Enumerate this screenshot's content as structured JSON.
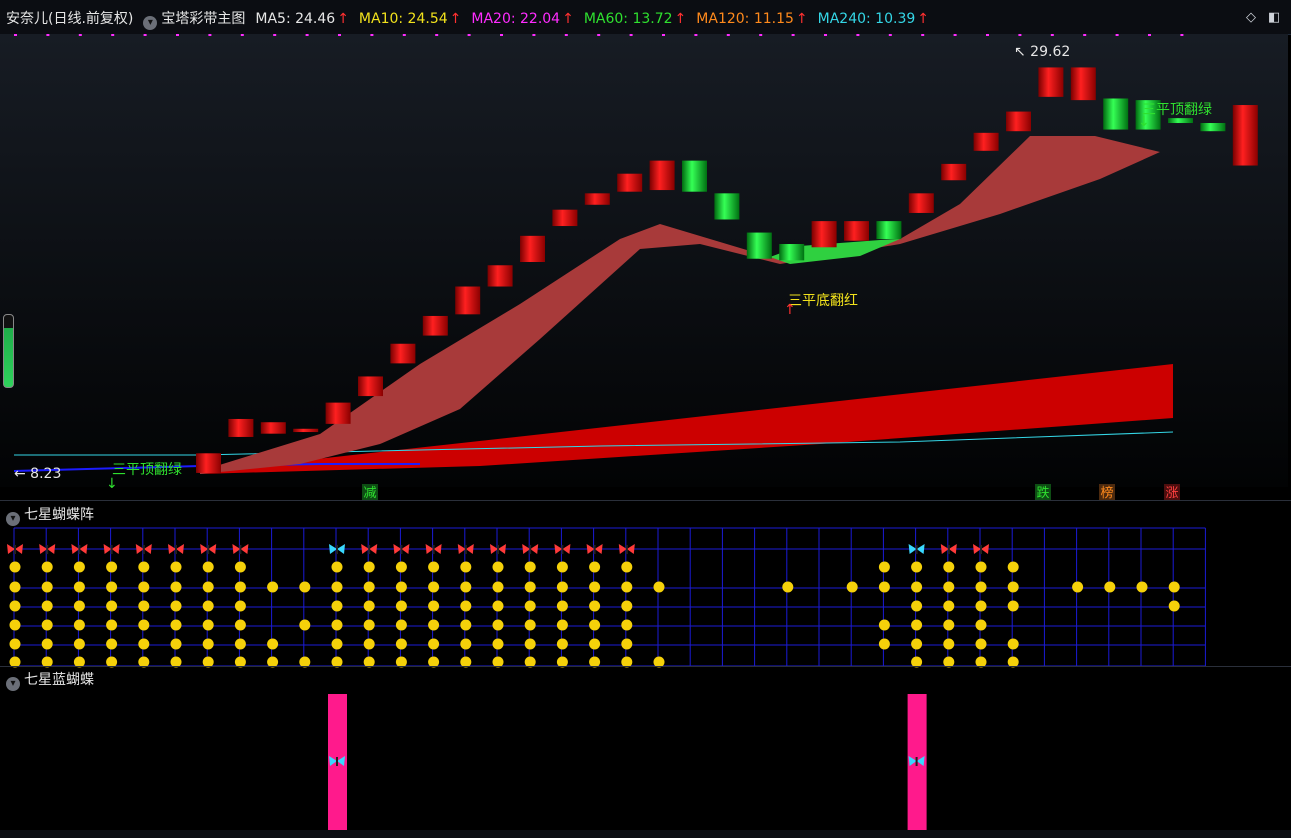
{
  "header": {
    "stock": "安奈儿(日线.前复权)",
    "indicator": "宝塔彩带主图",
    "ma": [
      {
        "label": "MA5:",
        "value": "24.46",
        "color": "#e6e6e6"
      },
      {
        "label": "MA10:",
        "value": "24.54",
        "color": "#f2e21c"
      },
      {
        "label": "MA20:",
        "value": "22.04",
        "color": "#ff2cff"
      },
      {
        "label": "MA60:",
        "value": "13.72",
        "color": "#2fe02f"
      },
      {
        "label": "MA120:",
        "value": "11.15",
        "color": "#ff8a1c"
      },
      {
        "label": "MA240:",
        "value": "10.39",
        "color": "#34d6e6"
      }
    ],
    "arrow": "↑"
  },
  "colors": {
    "up": "#e01010",
    "down": "#14c814",
    "ribbon": "#a83a3a",
    "ribbon2": "#cc0000",
    "grid": "#1b1bd6",
    "dot": "#f5d10a",
    "pink": "#ff1a8c"
  },
  "main": {
    "high_label": "29.62",
    "low_label": "8.23",
    "signals": [
      {
        "text": "三平顶翻绿",
        "color": "#2fe02f",
        "dir": "down"
      },
      {
        "text": "三平底翻红",
        "color": "#f2e21c",
        "dir": "up"
      },
      {
        "text": "三平顶翻绿",
        "color": "#2fe02f",
        "dir": "down"
      }
    ],
    "markers": [
      {
        "text": "减",
        "color": "#2fe02f",
        "bg": "#0e4d14"
      },
      {
        "text": "跌",
        "color": "#2fe02f",
        "bg": "#0e4d14"
      },
      {
        "text": "榜",
        "color": "#ff8a1c",
        "bg": "#4d2a0e"
      },
      {
        "text": "涨",
        "color": "#ff4040",
        "bg": "#4d0e0e"
      }
    ]
  },
  "chart_data": {
    "type": "candlestick",
    "candles": [
      {
        "open": 8.2,
        "close": 9.4
      },
      {
        "open": 10.4,
        "close": 11.5
      },
      {
        "open": 10.6,
        "close": 11.3
      },
      {
        "open": 10.7,
        "close": 10.9
      },
      {
        "open": 11.2,
        "close": 12.5
      },
      {
        "open": 12.9,
        "close": 14.1
      },
      {
        "open": 14.9,
        "close": 16.1
      },
      {
        "open": 16.6,
        "close": 17.8
      },
      {
        "open": 17.9,
        "close": 19.6
      },
      {
        "open": 19.6,
        "close": 20.9
      },
      {
        "open": 21.1,
        "close": 22.7
      },
      {
        "open": 23.3,
        "close": 24.3
      },
      {
        "open": 24.6,
        "close": 25.3
      },
      {
        "open": 25.4,
        "close": 26.5
      },
      {
        "open": 25.5,
        "close": 27.3
      },
      {
        "open": 27.3,
        "close": 25.4
      },
      {
        "open": 25.3,
        "close": 23.7
      },
      {
        "open": 22.9,
        "close": 21.3
      },
      {
        "open": 22.2,
        "close": 21.2
      },
      {
        "open": 22.0,
        "close": 23.6
      },
      {
        "open": 22.4,
        "close": 23.6
      },
      {
        "open": 23.6,
        "close": 22.5
      },
      {
        "open": 24.1,
        "close": 25.3
      },
      {
        "open": 26.1,
        "close": 27.1
      },
      {
        "open": 27.9,
        "close": 29.0
      },
      {
        "open": 29.1,
        "close": 30.3
      },
      {
        "open": 31.2,
        "close": 33.0
      },
      {
        "open": 31.0,
        "close": 33.0
      },
      {
        "open": 31.1,
        "close": 29.2
      },
      {
        "open": 31.0,
        "close": 29.2
      },
      {
        "open": 29.9,
        "close": 29.6
      },
      {
        "open": 29.6,
        "close": 29.1
      },
      {
        "open": 27.0,
        "close": 30.7
      }
    ],
    "ylim": [
      7.4,
      34.8
    ]
  },
  "butterfly_panel": {
    "title": "七星蝴蝶阵",
    "columns": [
      {
        "b": "r",
        "d": [
          1,
          1,
          1,
          1,
          1,
          1
        ]
      },
      {
        "b": "r",
        "d": [
          1,
          1,
          1,
          1,
          1,
          1
        ]
      },
      {
        "b": "r",
        "d": [
          1,
          1,
          1,
          1,
          1,
          1
        ]
      },
      {
        "b": "r",
        "d": [
          1,
          1,
          1,
          1,
          1,
          1
        ]
      },
      {
        "b": "r",
        "d": [
          1,
          1,
          1,
          1,
          1,
          1
        ]
      },
      {
        "b": "r",
        "d": [
          1,
          1,
          1,
          1,
          1,
          1
        ]
      },
      {
        "b": "r",
        "d": [
          1,
          1,
          1,
          1,
          1,
          1
        ]
      },
      {
        "b": "r",
        "d": [
          1,
          1,
          1,
          1,
          1,
          1
        ]
      },
      {
        "b": "",
        "d": [
          0,
          1,
          0,
          0,
          1,
          1
        ]
      },
      {
        "b": "",
        "d": [
          0,
          1,
          0,
          1,
          0,
          1
        ]
      },
      {
        "b": "c",
        "d": [
          1,
          1,
          1,
          1,
          1,
          1
        ]
      },
      {
        "b": "r",
        "d": [
          1,
          1,
          1,
          1,
          1,
          1
        ]
      },
      {
        "b": "r",
        "d": [
          1,
          1,
          1,
          1,
          1,
          1
        ]
      },
      {
        "b": "r",
        "d": [
          1,
          1,
          1,
          1,
          1,
          1
        ]
      },
      {
        "b": "r",
        "d": [
          1,
          1,
          1,
          1,
          1,
          1
        ]
      },
      {
        "b": "r",
        "d": [
          1,
          1,
          1,
          1,
          1,
          1
        ]
      },
      {
        "b": "r",
        "d": [
          1,
          1,
          1,
          1,
          1,
          1
        ]
      },
      {
        "b": "r",
        "d": [
          1,
          1,
          1,
          1,
          1,
          1
        ]
      },
      {
        "b": "r",
        "d": [
          1,
          1,
          1,
          1,
          1,
          1
        ]
      },
      {
        "b": "r",
        "d": [
          1,
          1,
          1,
          1,
          1,
          1
        ]
      },
      {
        "b": "",
        "d": [
          0,
          1,
          0,
          0,
          0,
          1
        ]
      },
      {
        "b": "",
        "d": [
          0,
          0,
          0,
          0,
          0,
          0
        ]
      },
      {
        "b": "",
        "d": [
          0,
          0,
          0,
          0,
          0,
          0
        ]
      },
      {
        "b": "",
        "d": [
          0,
          0,
          0,
          0,
          0,
          0
        ]
      },
      {
        "b": "",
        "d": [
          0,
          1,
          0,
          0,
          0,
          0
        ]
      },
      {
        "b": "",
        "d": [
          0,
          0,
          0,
          0,
          0,
          0
        ]
      },
      {
        "b": "",
        "d": [
          0,
          1,
          0,
          0,
          0,
          0
        ]
      },
      {
        "b": "",
        "d": [
          1,
          1,
          0,
          1,
          1,
          0
        ]
      },
      {
        "b": "c",
        "d": [
          1,
          1,
          1,
          1,
          1,
          1
        ]
      },
      {
        "b": "r",
        "d": [
          1,
          1,
          1,
          1,
          1,
          1
        ]
      },
      {
        "b": "r",
        "d": [
          1,
          1,
          1,
          1,
          1,
          1
        ]
      },
      {
        "b": "",
        "d": [
          1,
          1,
          1,
          0,
          1,
          1
        ]
      },
      {
        "b": "",
        "d": [
          0,
          0,
          0,
          0,
          0,
          0
        ]
      },
      {
        "b": "",
        "d": [
          0,
          1,
          0,
          0,
          0,
          0
        ]
      },
      {
        "b": "",
        "d": [
          0,
          1,
          0,
          0,
          0,
          0
        ]
      },
      {
        "b": "",
        "d": [
          0,
          1,
          0,
          0,
          0,
          0
        ]
      },
      {
        "b": "",
        "d": [
          0,
          1,
          1,
          0,
          0,
          0
        ]
      }
    ]
  },
  "blue_panel": {
    "title": "七星蓝蝴蝶",
    "bar_columns": [
      10,
      28
    ]
  }
}
